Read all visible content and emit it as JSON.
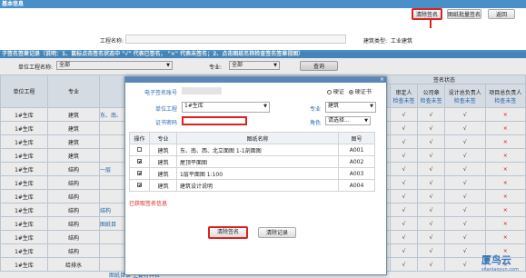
{
  "toolbar": {
    "clear_sign": "清除签名",
    "batch_sign": "图纸批量签名",
    "back": "返回"
  },
  "basic_info": {
    "header": "基本信息",
    "project_label": "工程名称:",
    "project_value": "",
    "type_label": "建筑类型:",
    "type_value": "工业建筑"
  },
  "sign_record": {
    "header": "子签名签章记录（说明：1、鼠标点击签名状态中 \"√\" 代表已签名， \"×\" 代表未签名；2、点击图纸名称检查签名签章视图）",
    "unit_label": "单位工程名称:",
    "unit_value": "全部",
    "major_label": "专业:",
    "major_value": "全部",
    "query": "查询"
  },
  "main_table": {
    "col_unit": "单位工程",
    "col_major": "专业",
    "col_status": "签名状态",
    "role_cols": [
      "审核人",
      "审定人",
      "公司章",
      "设计总负责人",
      "项目总负责人"
    ],
    "check_label": "检查未签",
    "rows": [
      {
        "unit": "1#生库",
        "major": "建筑",
        "drawing": "东、南、",
        "marks": [
          "√",
          "√",
          "√",
          "√",
          "×"
        ]
      },
      {
        "unit": "1#生库",
        "major": "建筑",
        "drawing": "",
        "marks": [
          "√",
          "√",
          "√",
          "√",
          "×"
        ]
      },
      {
        "unit": "1#生库",
        "major": "建筑",
        "drawing": "",
        "marks": [
          "√",
          "√",
          "√",
          "√",
          "×"
        ]
      },
      {
        "unit": "1#生库",
        "major": "建筑",
        "drawing": "",
        "marks": [
          "√",
          "√",
          "√",
          "√",
          "×"
        ]
      },
      {
        "unit": "1#生库",
        "major": "结构",
        "drawing": "一层",
        "marks": [
          "√",
          "√",
          "√",
          "√",
          "×"
        ]
      },
      {
        "unit": "1#生库",
        "major": "结构",
        "drawing": "",
        "marks": [
          "√",
          "√",
          "√",
          "√",
          "×"
        ]
      },
      {
        "unit": "1#生库",
        "major": "结构",
        "drawing": "",
        "marks": [
          "√",
          "√",
          "√",
          "√",
          "×"
        ]
      },
      {
        "unit": "1#生库",
        "major": "结构",
        "drawing": "结构",
        "marks": [
          "√",
          "√",
          "√",
          "√",
          "×"
        ]
      },
      {
        "unit": "1#生库",
        "major": "结构",
        "drawing": "图纸目",
        "marks": [
          "√",
          "√",
          "√",
          "√",
          "×"
        ]
      },
      {
        "unit": "1#生库",
        "major": "结构",
        "drawing": "",
        "marks": [
          "√",
          "√",
          "√",
          "√",
          "×"
        ]
      },
      {
        "unit": "1#生库",
        "major": "结构",
        "drawing": "",
        "marks": [
          "√",
          "√",
          "√",
          "√",
          "×"
        ]
      },
      {
        "unit": "1#生库",
        "major": "给排水",
        "drawing": "",
        "marks": [
          "√",
          "√",
          "√",
          "√",
          "×"
        ]
      }
    ],
    "bottom_link": "图纸目录   主要材料表   "
  },
  "dialog": {
    "account_label": "电子签名账号",
    "account_value": "",
    "cert_hard": "硬证",
    "cert_soft": "硬证书",
    "unit_label": "单位工程",
    "unit_value": "1#生库",
    "major_label": "专业",
    "major_value": "建筑",
    "cert_code_label": "证书密码",
    "cert_code_value": "",
    "role_label": "角色",
    "role_value": "请选择...",
    "table_headers": [
      "操作",
      "专业",
      "图纸名称",
      "图号"
    ],
    "rows": [
      {
        "checked": false,
        "major": "建筑",
        "name": "东、南、西、北立面图 1-1剖面图",
        "num": "A001"
      },
      {
        "checked": true,
        "major": "建筑",
        "name": "屋顶平面图",
        "num": "A002"
      },
      {
        "checked": true,
        "major": "建筑",
        "name": "1层平面图 1:100",
        "num": "A003"
      },
      {
        "checked": true,
        "major": "建筑",
        "name": "建筑设计说明",
        "num": "A004"
      }
    ],
    "note": "已获取签名信息",
    "clear_sign": "清除签名",
    "clear_record": "清除记录"
  },
  "watermark": {
    "brand": "厦鸟云",
    "url": "shaniaoyun.com"
  }
}
